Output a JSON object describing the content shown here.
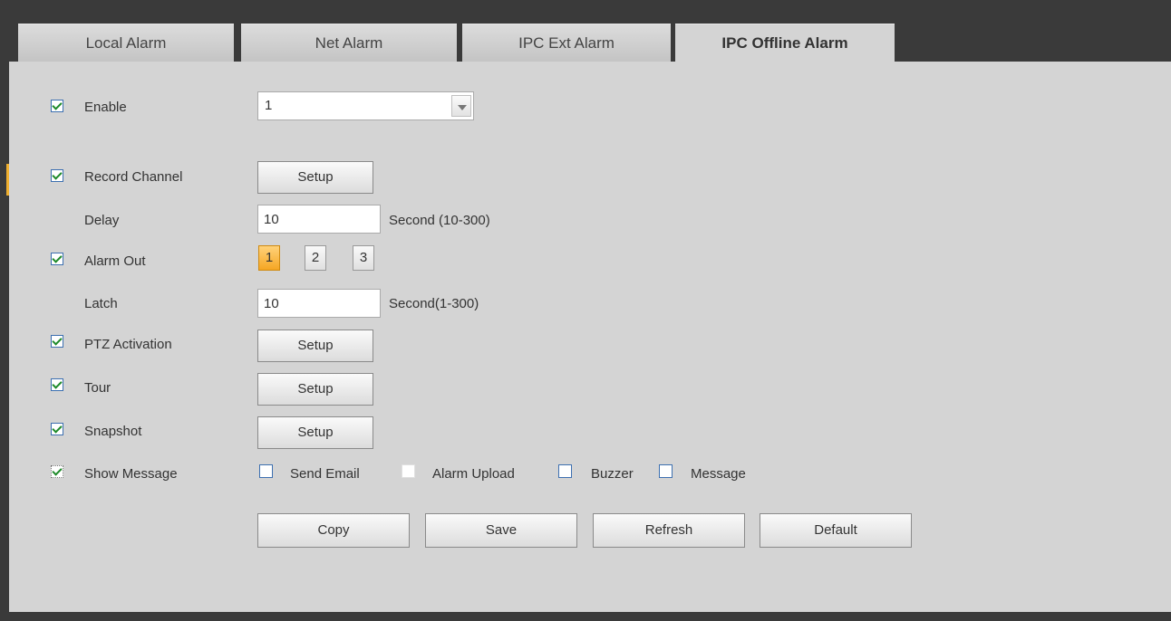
{
  "tabs": [
    {
      "label": "Local Alarm"
    },
    {
      "label": "Net Alarm"
    },
    {
      "label": "IPC Ext Alarm"
    },
    {
      "label": "IPC Offline Alarm"
    }
  ],
  "form": {
    "enable": {
      "label": "Enable",
      "checked": true,
      "channel": "1"
    },
    "record_channel": {
      "label": "Record Channel",
      "checked": true,
      "button": "Setup"
    },
    "delay": {
      "label": "Delay",
      "value": "10",
      "unit": "Second (10-300)"
    },
    "alarm_out": {
      "label": "Alarm Out",
      "checked": true,
      "outputs": [
        "1",
        "2",
        "3"
      ],
      "selected": "1"
    },
    "latch": {
      "label": "Latch",
      "value": "10",
      "unit": "Second(1-300)"
    },
    "ptz_activation": {
      "label": "PTZ Activation",
      "checked": true,
      "button": "Setup"
    },
    "tour": {
      "label": "Tour",
      "checked": true,
      "button": "Setup"
    },
    "snapshot": {
      "label": "Snapshot",
      "checked": true,
      "button": "Setup"
    },
    "show_message": {
      "label": "Show Message",
      "checked": true
    },
    "send_email": {
      "label": "Send Email",
      "checked": false
    },
    "alarm_upload": {
      "label": "Alarm Upload",
      "checked": false
    },
    "buzzer": {
      "label": "Buzzer",
      "checked": false
    },
    "message": {
      "label": "Message",
      "checked": false
    }
  },
  "actions": {
    "copy": "Copy",
    "save": "Save",
    "refresh": "Refresh",
    "default": "Default"
  },
  "colors": {
    "panel_bg": "#d4d4d4",
    "tab_bar_bg": "#3a3a3a",
    "check_green": "#1e8a2a",
    "selected_output": "#f5a623"
  }
}
